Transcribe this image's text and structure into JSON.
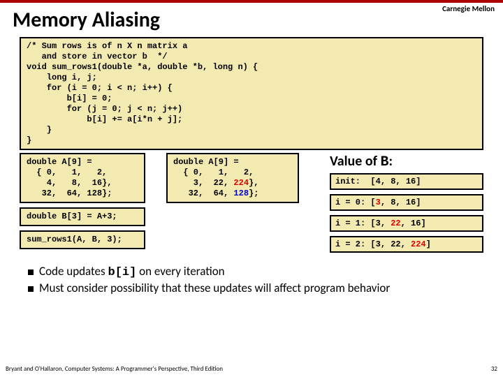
{
  "brand": "Carnegie Mellon",
  "title": "Memory Aliasing",
  "code_main": "/* Sum rows is of n X n matrix a\n   and store in vector b  */\nvoid sum_rows1(double *a, double *b, long n) {\n    long i, j;\n    for (i = 0; i < n; i++) {\n        b[i] = 0;\n        for (j = 0; j < n; j++)\n            b[i] += a[i*n + j];\n    }\n}",
  "code_A_plain": "double A[9] =\n  { 0,   1,   2,\n    4,   8,  16},\n   32,  64, 128};",
  "code_A_red": {
    "pre": "double A[9] =\n  { 0,   1,   2,\n    3,  22, ",
    "r1": "224",
    "mid1": "},\n   32,  64, ",
    "r2": "128",
    "post": "};"
  },
  "code_B": "double B[3] = A+3;",
  "code_call": "sum_rows1(A, B, 3);",
  "value_title_pre": "Value of ",
  "value_title_mono": "B",
  "value_title_post": ":",
  "results": {
    "init": {
      "label": "init:  ",
      "arr": "[4, 8, 16]",
      "hl": -1
    },
    "i0": {
      "label": "i = 0: ",
      "arr": "[3, 8, 16]",
      "hl": 0
    },
    "i1": {
      "label": "i = 1: ",
      "arr": "[3, 22, 16]",
      "hl": 1
    },
    "i2": {
      "label": "i = 2: ",
      "arr": "[3, 22, 224]",
      "hl": 2
    }
  },
  "bullets": {
    "b1_pre": "Code updates ",
    "b1_code": "b[i]",
    "b1_post": " on every iteration",
    "b2": "Must consider possibility that these updates will affect program behavior"
  },
  "footer_left": "Bryant and O'Hallaron, Computer Systems: A Programmer's Perspective, Third Edition",
  "footer_right": "32"
}
